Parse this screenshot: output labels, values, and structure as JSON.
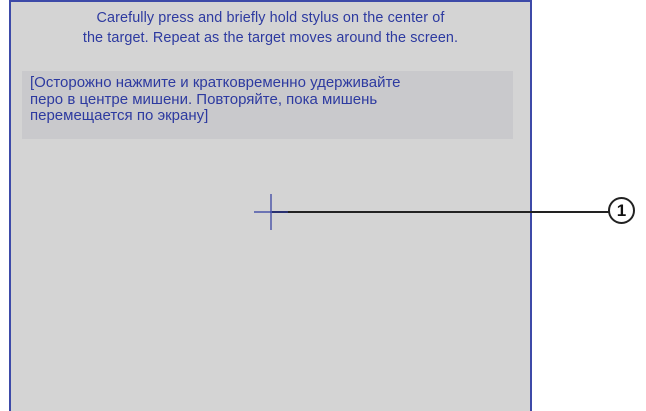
{
  "instruction_en": {
    "line1": "Carefully press and briefly hold stylus on the center of",
    "line2": "the target. Repeat as the target moves around the screen."
  },
  "instruction_ru": {
    "line1": "[Осторожно нажмите и кратковременно удерживайте",
    "line2": "перо в центре мишени. Повторяйте, пока мишень",
    "line3": "перемещается по экрану]"
  },
  "callout": {
    "number": "1"
  },
  "colors": {
    "screen_bg": "#d4d4d4",
    "text": "#2d3aa0",
    "border": "#3d4aa8",
    "translation_bg": "#c9c9cc"
  },
  "icons": {
    "target": "crosshair-target-icon"
  }
}
